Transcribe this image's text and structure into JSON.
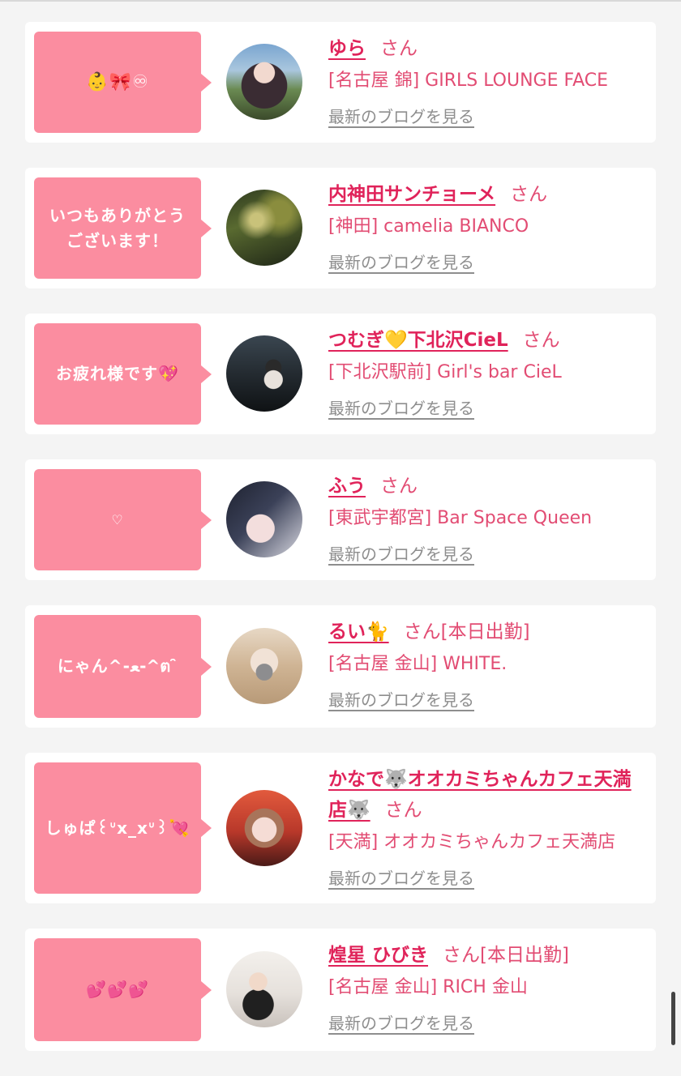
{
  "common": {
    "san": "さん",
    "blog_label": "最新のブログを見る"
  },
  "cards": [
    {
      "bubble": "👶🎀♾",
      "name": "ゆら",
      "status": "",
      "shop": "[名古屋 錦] GIRLS LOUNGE FACE"
    },
    {
      "bubble": "いつもありがとう\nございます！",
      "name": "内神田サンチョーメ",
      "status": "",
      "shop": "[神田] camelia BIANCO"
    },
    {
      "bubble": "お疲れ様です💖",
      "name": "つむぎ💛下北沢CieL",
      "status": "",
      "shop": "[下北沢駅前] Girl's bar CieL"
    },
    {
      "bubble": "♡",
      "name": "ふう",
      "status": "",
      "shop": "[東武宇都宮] Bar Space Queen"
    },
    {
      "bubble": "にゃん^-ﻌ-^ต ̑̑",
      "name": "るい🐈",
      "status": "[本日出勤]",
      "shop": "[名古屋 金山] WHITE."
    },
    {
      "bubble": "しゅぱ꒰ᐡx_xᐡ꒱💘",
      "name": "かなで🐺オオカミちゃんカフェ天満店🐺",
      "status": "",
      "shop": "[天満] オオカミちゃんカフェ天満店"
    },
    {
      "bubble": "💕💕💕",
      "name": "煌星 ひびき",
      "status": "[本日出勤]",
      "shop": "[名古屋 金山] RICH 金山"
    }
  ]
}
